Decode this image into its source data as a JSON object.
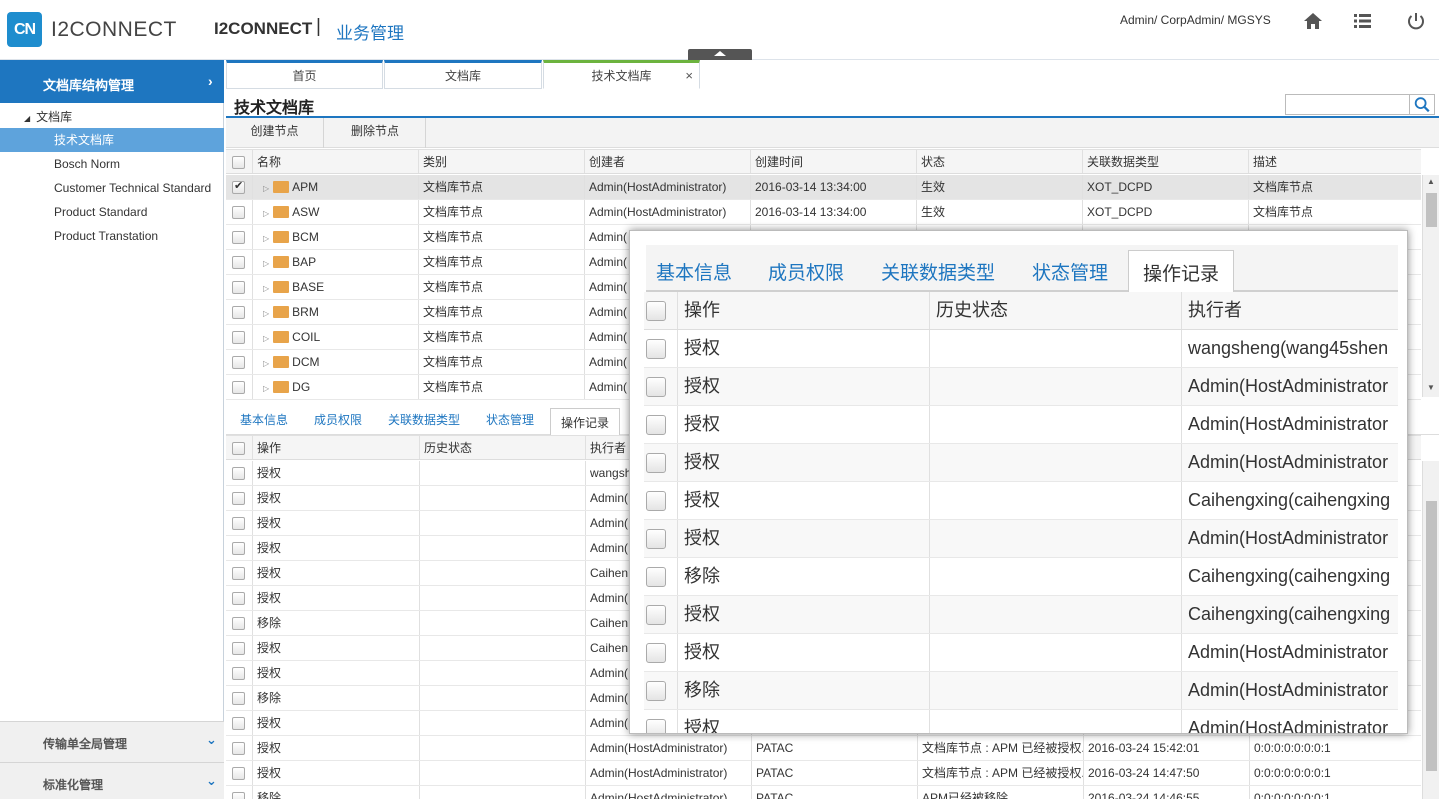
{
  "header": {
    "logo_mark": "CN",
    "logo_text": "I2CONNECT",
    "brand": "I2CONNECT",
    "separator": "|",
    "module": "业务管理",
    "user": "Admin/ CorpAdmin/ MGSYS",
    "icons": [
      "home-icon",
      "list-icon",
      "power-icon"
    ]
  },
  "sidebar": {
    "active_section": "文档库结构管理",
    "active_arrow": "›",
    "tree_root": "文档库",
    "tree_items": [
      {
        "label": "技术文档库",
        "selected": true
      },
      {
        "label": "Bosch Norm"
      },
      {
        "label": "Customer Technical Standard"
      },
      {
        "label": "Product Standard"
      },
      {
        "label": "Product Transtation"
      }
    ],
    "bottom_sections": [
      "传输单全局管理",
      "标准化管理"
    ],
    "bottom_arrow": "⌄"
  },
  "tabs": [
    {
      "label": "首页"
    },
    {
      "label": "文档库"
    },
    {
      "label": "技术文档库",
      "active": true,
      "close": "×"
    }
  ],
  "page": {
    "title": "技术文档库",
    "toolbar": {
      "create": "创建节点",
      "delete": "删除节点"
    }
  },
  "node_grid": {
    "columns": [
      "名称",
      "类别",
      "创建者",
      "创建时间",
      "状态",
      "关联数据类型",
      "描述"
    ],
    "rows": [
      {
        "name": "APM",
        "category": "文档库节点",
        "creator": "Admin(HostAdministrator)",
        "created": "2016-03-14 13:34:00",
        "status": "生效",
        "type": "XOT_DCPD",
        "desc": "文档库节点",
        "checked": true
      },
      {
        "name": "ASW",
        "category": "文档库节点",
        "creator": "Admin(HostAdministrator)",
        "created": "2016-03-14 13:34:00",
        "status": "生效",
        "type": "XOT_DCPD",
        "desc": "文档库节点"
      },
      {
        "name": "BCM",
        "category": "文档库节点",
        "creator": "Admin(",
        "created": "",
        "status": "",
        "type": "",
        "desc": ""
      },
      {
        "name": "BAP",
        "category": "文档库节点",
        "creator": "Admin(",
        "created": "",
        "status": "",
        "type": "",
        "desc": ""
      },
      {
        "name": "BASE",
        "category": "文档库节点",
        "creator": "Admin(",
        "created": "",
        "status": "",
        "type": "",
        "desc": ""
      },
      {
        "name": "BRM",
        "category": "文档库节点",
        "creator": "Admin(",
        "created": "",
        "status": "",
        "type": "",
        "desc": ""
      },
      {
        "name": "COIL",
        "category": "文档库节点",
        "creator": "Admin(",
        "created": "",
        "status": "",
        "type": "",
        "desc": ""
      },
      {
        "name": "DCM",
        "category": "文档库节点",
        "creator": "Admin(",
        "created": "",
        "status": "",
        "type": "",
        "desc": ""
      },
      {
        "name": "DG",
        "category": "文档库节点",
        "creator": "Admin(",
        "created": "",
        "status": "",
        "type": "",
        "desc": ""
      }
    ]
  },
  "detail_tabs": [
    "基本信息",
    "成员权限",
    "关联数据类型",
    "状态管理",
    "操作记录"
  ],
  "log_grid": {
    "columns": [
      "操作",
      "历史状态",
      "执行者"
    ],
    "rows": [
      {
        "op": "授权",
        "exec": "wangsh"
      },
      {
        "op": "授权",
        "exec": "Admin("
      },
      {
        "op": "授权",
        "exec": "Admin("
      },
      {
        "op": "授权",
        "exec": "Admin("
      },
      {
        "op": "授权",
        "exec": "Caihen"
      },
      {
        "op": "授权",
        "exec": "Admin("
      },
      {
        "op": "移除",
        "exec": "Caihen"
      },
      {
        "op": "授权",
        "exec": "Caihen"
      },
      {
        "op": "授权",
        "exec": "Admin("
      },
      {
        "op": "移除",
        "exec": "Admin("
      },
      {
        "op": "授权",
        "exec": "Admin("
      },
      {
        "op": "授权",
        "exec": "Admin(HostAdministrator)",
        "target": "PATAC",
        "detail": "文档库节点 : APM 已经被授权.",
        "time": "2016-03-24 15:42:01",
        "ip": "0:0:0:0:0:0:0:1"
      },
      {
        "op": "授权",
        "exec": "Admin(HostAdministrator)",
        "target": "PATAC",
        "detail": "文档库节点 : APM 已经被授权.",
        "time": "2016-03-24 14:47:50",
        "ip": "0:0:0:0:0:0:0:1"
      },
      {
        "op": "移除",
        "exec": "Admin(HostAdministrator)",
        "target": "PATAC",
        "detail": "APM已经被移除",
        "time": "2016-03-24 14:46:55",
        "ip": "0:0:0:0:0:0:0:1"
      }
    ]
  },
  "zoom": {
    "tabs": [
      "基本信息",
      "成员权限",
      "关联数据类型",
      "状态管理",
      "操作记录"
    ],
    "columns": [
      "操作",
      "历史状态",
      "执行者"
    ],
    "rows": [
      {
        "op": "授权",
        "exec": "wangsheng(wang45shen"
      },
      {
        "op": "授权",
        "exec": "Admin(HostAdministrator"
      },
      {
        "op": "授权",
        "exec": "Admin(HostAdministrator"
      },
      {
        "op": "授权",
        "exec": "Admin(HostAdministrator"
      },
      {
        "op": "授权",
        "exec": "Caihengxing(caihengxing"
      },
      {
        "op": "授权",
        "exec": "Admin(HostAdministrator"
      },
      {
        "op": "移除",
        "exec": "Caihengxing(caihengxing"
      },
      {
        "op": "授权",
        "exec": "Caihengxing(caihengxing"
      },
      {
        "op": "授权",
        "exec": "Admin(HostAdministrator"
      },
      {
        "op": "移除",
        "exec": "Admin(HostAdministrator"
      },
      {
        "op": "授权",
        "exec": "Admin(HostAdministrator"
      }
    ]
  }
}
